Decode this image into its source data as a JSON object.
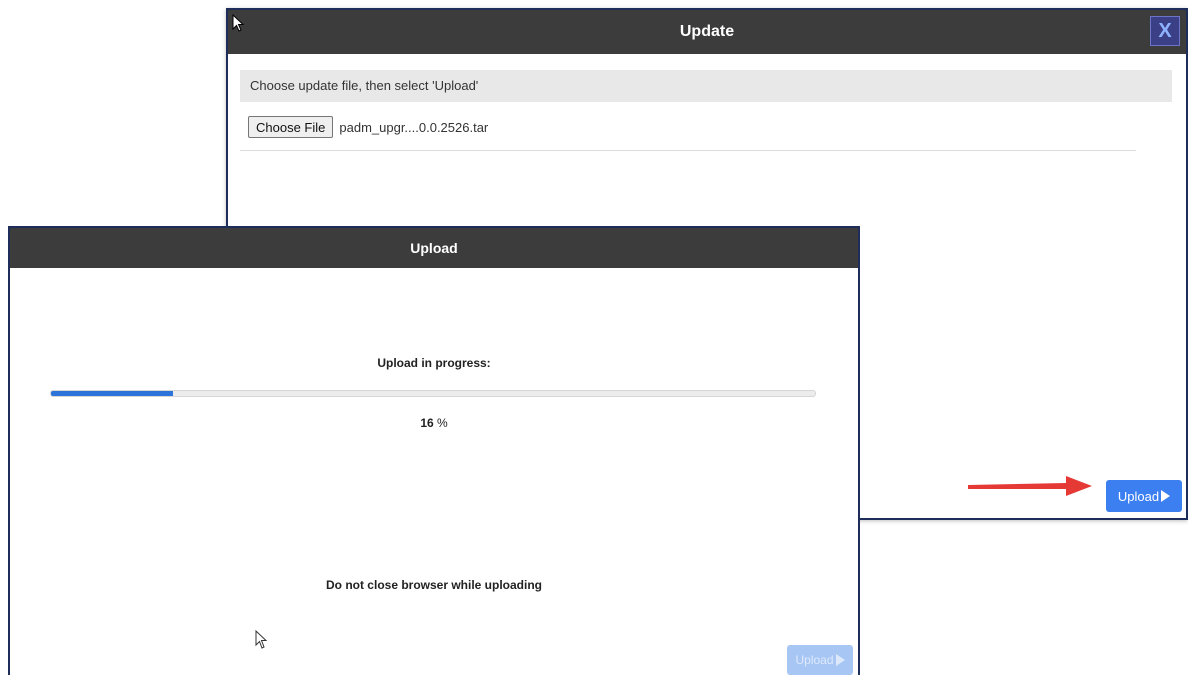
{
  "update_dialog": {
    "title": "Update",
    "close_label": "X",
    "instruction": "Choose update file, then select 'Upload'",
    "choose_file_label": "Choose File",
    "file_name": "padm_upgr....0.0.2526.tar",
    "upload_button_label": "Upload",
    "close_button_color": "#3a3f86",
    "titlebar_color": "#3c3c3c"
  },
  "upload_dialog": {
    "title": "Upload",
    "progress_label": "Upload in progress:",
    "progress_percent": 16,
    "progress_value": "16",
    "progress_unit": "%",
    "warning": "Do not close browser while uploading",
    "upload_button_label": "Upload",
    "upload_button_disabled": true,
    "progress_color": "#2d74da"
  },
  "annotations": {
    "arrow_color": "#e53935",
    "arrow_icon": "red-arrow-icon"
  }
}
